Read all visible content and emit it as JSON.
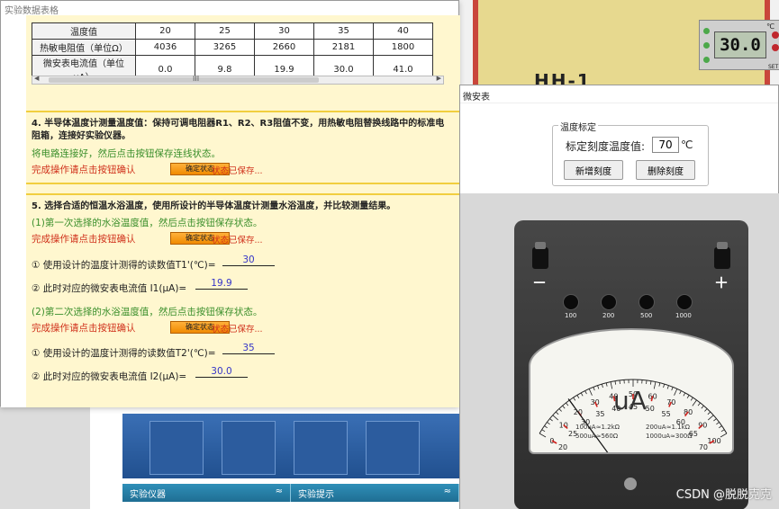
{
  "data_window": {
    "title": "实验数据表格",
    "table": {
      "rows": [
        {
          "label": "温度值",
          "values": [
            "20",
            "25",
            "30",
            "35",
            "40"
          ]
        },
        {
          "label": "热敏电阻值（单位Ω）",
          "values": [
            "4036",
            "3265",
            "2660",
            "2181",
            "1800"
          ]
        },
        {
          "label": "微安表电流值（单位μA）",
          "values": [
            "0.0",
            "9.8",
            "19.9",
            "30.0",
            "41.0"
          ]
        }
      ],
      "scroll_grip": "III"
    },
    "section4": {
      "title": "4. 半导体温度计测量温度值：保持可调电阻器R1、R2、R3阻值不变，用热敏电阻替换线路中的标准电阻箱，连接好实验仪器。",
      "instruction": "将电路连接好，然后点击按钮保存连线状态。",
      "confirm_prompt": "完成操作请点击按钮确认",
      "confirm_button": "确定状态",
      "status": "状态已保存..."
    },
    "section5": {
      "title": "5. 选择合适的恒温水浴温度，使用所设计的半导体温度计测量水浴温度，并比较测量结果。",
      "first_instruction": "(1)第一次选择的水浴温度值，然后点击按钮保存状态。",
      "confirm_prompt": "完成操作请点击按钮确认",
      "confirm_button": "确定状态",
      "status": "状态已保存...",
      "t1_label": "① 使用设计的温度计测得的读数值T1'(℃)=",
      "t1_value": "30",
      "i1_label": "② 此时对应的微安表电流值 I1(μA)=",
      "i1_value": "19.9",
      "second_instruction": "(2)第二次选择的水浴温度值，然后点击按钮保存状态。",
      "t2_label": "① 使用设计的温度计测得的读数值T2'(℃)=",
      "t2_value": "35",
      "i2_label": "② 此时对应的微安表电流值 I2(μA)=",
      "i2_value": "30.0"
    }
  },
  "hh1": {
    "label": "HH-1",
    "display": "30.0",
    "unit": "℃",
    "set_label": "SET"
  },
  "meter_window": {
    "title": "微安表",
    "calibration": {
      "legend": "温度标定",
      "label": "标定刻度温度值:",
      "value": "70",
      "unit": "℃",
      "add_button": "新增刻度",
      "delete_button": "删除刻度"
    },
    "terminals": {
      "minus": "－",
      "plus": "＋"
    },
    "ranges": [
      "100",
      "200",
      "500",
      "1000"
    ],
    "dial": {
      "unit": "uA",
      "scale_numbers": [
        "0",
        "10",
        "20",
        "30",
        "40",
        "50",
        "60",
        "70",
        "80",
        "90",
        "100"
      ],
      "temperature_marks": [
        "20",
        "25",
        "30",
        "35",
        "40",
        "45",
        "50",
        "55",
        "60",
        "65",
        "70"
      ],
      "spec_left_1": "100uA≈1.2kΩ",
      "spec_left_2": "500uA≈560Ω",
      "spec_right_1": "200uA≈1.1kΩ",
      "spec_right_2": "1000uA≈300Ω",
      "reading_ua": 19.9
    }
  },
  "bottom_bar": {
    "left_tab": "实验仪器",
    "left_icon": "≈",
    "right_tab": "实验提示",
    "right_icon": "≈"
  },
  "watermark": "CSDN @脱脱克克"
}
